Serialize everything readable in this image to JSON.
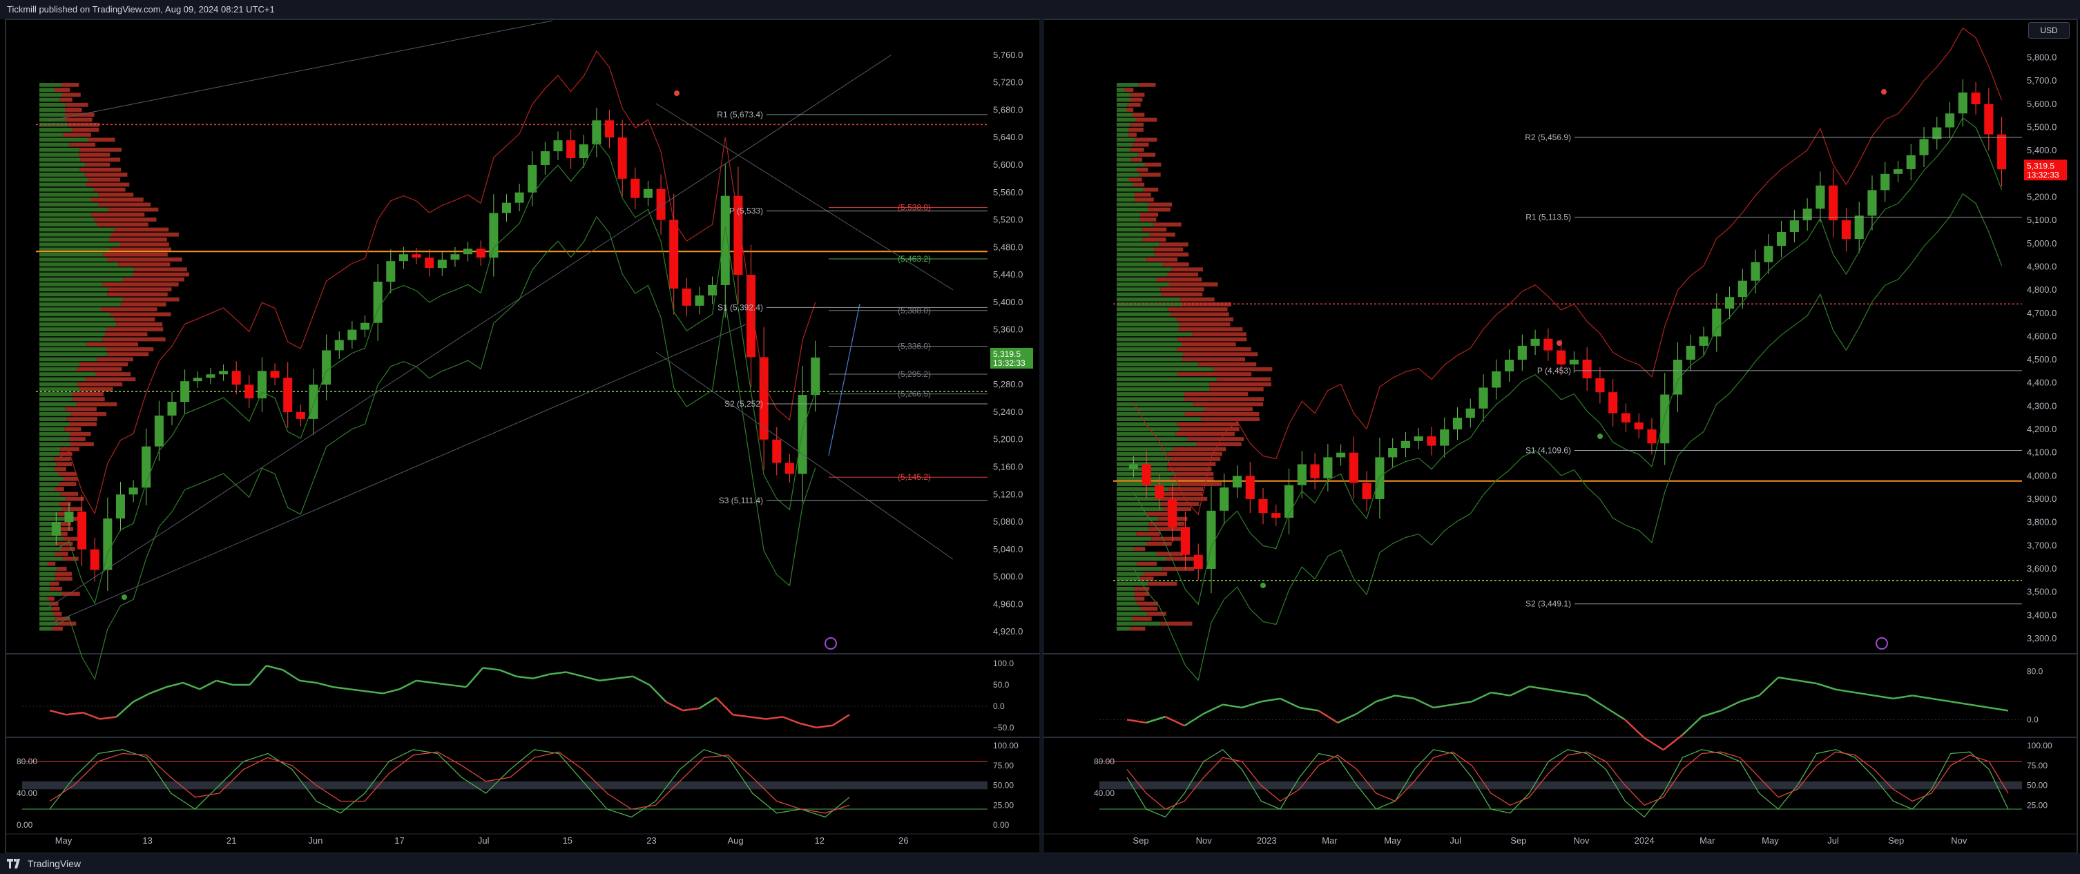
{
  "header": {
    "publisher_line": "Tickmill published on TradingView.com, Aug 09, 2024 08:21 UTC+1"
  },
  "footer": {
    "brand": "TradingView"
  },
  "currency_button": "USD",
  "colors": {
    "up": "#3f9c35",
    "down": "#f20e0e",
    "background": "#000000",
    "panel_border": "#2a2e39",
    "poc": "#f7931e",
    "lime": "#8bd44a"
  },
  "chart_data": [
    {
      "type": "candlestick",
      "panel": "left",
      "ylim": [
        4900,
        5780
      ],
      "y_ticks": [
        "5,760.0",
        "5,720.0",
        "5,680.0",
        "5,640.0",
        "5,600.0",
        "5,560.0",
        "5,520.0",
        "5,480.0",
        "5,440.0",
        "5,400.0",
        "5,360.0",
        "5,320.0",
        "5,280.0",
        "5,240.0",
        "5,200.0",
        "5,160.0",
        "5,120.0",
        "5,080.0",
        "5,040.0",
        "5,000.0",
        "4,960.0",
        "4,920.0"
      ],
      "x_labels": [
        "May",
        "13",
        "21",
        "Jun",
        "17",
        "Jul",
        "15",
        "23",
        "Aug",
        "12",
        "26"
      ],
      "last_price": {
        "value": "5,319.5",
        "countdown": "13:32:33"
      },
      "levels": [
        {
          "label": "R1 (5,673.4)",
          "value": 5673.4
        },
        {
          "label": "P (5,533)",
          "value": 5533
        },
        {
          "label": "(5,538.0)",
          "value": 5538
        },
        {
          "label": "(5,463.2)",
          "value": 5463.2
        },
        {
          "label": "S1 (5,392.4)",
          "value": 5392.4
        },
        {
          "label": "(5,388.0)",
          "value": 5388
        },
        {
          "label": "(5,336.0)",
          "value": 5336
        },
        {
          "label": "(5,295.2)",
          "value": 5295.2
        },
        {
          "label": "(5,266.5)",
          "value": 5266.5
        },
        {
          "label": "S2 (5,252)",
          "value": 5252
        },
        {
          "label": "(5,145.2)",
          "value": 5145.2
        },
        {
          "label": "S3 (5,111.4)",
          "value": 5111.4
        }
      ],
      "series": [
        {
          "name": "",
          "values": [
            5080,
            5095,
            5040,
            5010,
            5085,
            5120,
            5130,
            5190,
            5235,
            5255,
            5285,
            5290,
            5295,
            5300,
            5280,
            5260,
            5300,
            5290,
            5240,
            5230,
            5280,
            5330,
            5345,
            5360,
            5370,
            5430,
            5460,
            5470,
            5465,
            5450,
            5462,
            5470,
            5478,
            5465,
            5530,
            5545,
            5560,
            5600,
            5620,
            5636,
            5610,
            5630,
            5665,
            5640,
            5580,
            5552,
            5565,
            5520,
            5420,
            5395,
            5410,
            5425,
            5555,
            5440,
            5320,
            5200,
            5166,
            5150,
            5265,
            5319.5
          ]
        }
      ]
    },
    {
      "type": "oscillator",
      "panel": "left",
      "ylim": [
        -60,
        110
      ],
      "y_ticks": [
        "100.0",
        "50.0",
        "0.0",
        "−50.0"
      ],
      "series": [
        {
          "name": "",
          "values": [
            -10,
            -20,
            -15,
            -30,
            -25,
            10,
            30,
            45,
            55,
            40,
            60,
            50,
            50,
            95,
            85,
            60,
            55,
            45,
            40,
            35,
            30,
            40,
            60,
            55,
            50,
            45,
            90,
            85,
            70,
            65,
            75,
            80,
            70,
            60,
            65,
            70,
            50,
            10,
            -10,
            -5,
            20,
            -20,
            -25,
            -30,
            -25,
            -40,
            -50,
            -45,
            -20
          ]
        }
      ]
    },
    {
      "type": "stochastic",
      "panel": "left",
      "ylim": [
        0,
        100
      ],
      "y_ticks": [
        "100.00",
        "75.00",
        "50.00",
        "25.00",
        "0.00"
      ],
      "left_ticks": [
        "80.00",
        "40.00",
        "0.00"
      ],
      "series": [
        {
          "name": "",
          "values": [
            20,
            60,
            90,
            95,
            85,
            40,
            20,
            50,
            80,
            90,
            70,
            30,
            15,
            40,
            80,
            95,
            90,
            60,
            40,
            70,
            95,
            90,
            55,
            20,
            10,
            30,
            70,
            95,
            85,
            40,
            15,
            20,
            10,
            35
          ]
        },
        {
          "name": "",
          "values": [
            30,
            50,
            80,
            90,
            88,
            60,
            35,
            40,
            70,
            85,
            75,
            50,
            30,
            30,
            65,
            88,
            92,
            75,
            55,
            60,
            85,
            92,
            70,
            40,
            20,
            25,
            55,
            85,
            88,
            60,
            30,
            20,
            15,
            25
          ]
        }
      ]
    },
    {
      "type": "candlestick",
      "panel": "right",
      "ylim": [
        3270,
        5870
      ],
      "y_ticks": [
        "5,800.0",
        "5,700.0",
        "5,600.0",
        "5,500.0",
        "5,400.0",
        "5,300.0",
        "5,200.0",
        "5,100.0",
        "5,000.0",
        "4,900.0",
        "4,800.0",
        "4,700.0",
        "4,600.0",
        "4,500.0",
        "4,400.0",
        "4,300.0",
        "4,200.0",
        "4,100.0",
        "4,000.0",
        "3,900.0",
        "3,800.0",
        "3,700.0",
        "3,600.0",
        "3,500.0",
        "3,400.0",
        "3,300.0"
      ],
      "x_labels": [
        "Sep",
        "Nov",
        "2023",
        "Mar",
        "May",
        "Jul",
        "Sep",
        "Nov",
        "2024",
        "Mar",
        "May",
        "Jul",
        "Sep",
        "Nov"
      ],
      "last_price": {
        "value": "5,319.5",
        "countdown": "13:32:33"
      },
      "levels": [
        {
          "label": "R2 (5,456.9)",
          "value": 5456.9
        },
        {
          "label": "R1 (5,113.5)",
          "value": 5113.5
        },
        {
          "label": "P (4,453)",
          "value": 4453
        },
        {
          "label": "S1 (4,109.6)",
          "value": 4109.6
        },
        {
          "label": "S2 (3,449.1)",
          "value": 3449.1
        }
      ],
      "series": [
        {
          "name": "",
          "values": [
            4050,
            3960,
            3900,
            3780,
            3660,
            3600,
            3850,
            3950,
            4000,
            3900,
            3840,
            3820,
            3960,
            4050,
            3990,
            4080,
            4100,
            3970,
            3900,
            4080,
            4120,
            4150,
            4170,
            4130,
            4200,
            4250,
            4290,
            4380,
            4450,
            4500,
            4560,
            4590,
            4540,
            4480,
            4500,
            4420,
            4360,
            4270,
            4230,
            4200,
            4140,
            4350,
            4500,
            4560,
            4600,
            4720,
            4770,
            4840,
            4920,
            4990,
            5050,
            5100,
            5150,
            5250,
            5100,
            5020,
            5120,
            5230,
            5300,
            5320,
            5380,
            5450,
            5500,
            5560,
            5650,
            5600,
            5470,
            5319.5
          ]
        }
      ]
    },
    {
      "type": "oscillator",
      "panel": "right",
      "ylim": [
        -20,
        100
      ],
      "y_ticks": [
        "80.0",
        "0.0"
      ],
      "series": [
        {
          "name": "",
          "values": [
            0,
            -5,
            5,
            -10,
            10,
            25,
            20,
            30,
            35,
            20,
            15,
            -5,
            10,
            30,
            40,
            35,
            20,
            25,
            30,
            45,
            40,
            55,
            50,
            45,
            40,
            20,
            0,
            -30,
            -50,
            -25,
            5,
            15,
            30,
            40,
            70,
            65,
            60,
            50,
            45,
            40,
            35,
            40,
            35,
            30,
            25,
            20,
            15
          ]
        }
      ]
    },
    {
      "type": "stochastic",
      "panel": "right",
      "ylim": [
        0,
        100
      ],
      "y_ticks": [
        "100.00",
        "75.00",
        "50.00",
        "25.00"
      ],
      "left_ticks": [
        "80.00",
        "40.00"
      ],
      "series": [
        {
          "name": "",
          "values": [
            60,
            20,
            10,
            40,
            80,
            95,
            70,
            30,
            20,
            60,
            90,
            85,
            50,
            20,
            30,
            70,
            95,
            90,
            60,
            20,
            15,
            40,
            80,
            95,
            90,
            70,
            30,
            10,
            40,
            85,
            95,
            90,
            80,
            40,
            20,
            50,
            90,
            95,
            85,
            60,
            30,
            20,
            45,
            90,
            92,
            70,
            20
          ]
        },
        {
          "name": "",
          "values": [
            70,
            40,
            20,
            30,
            60,
            85,
            80,
            50,
            30,
            45,
            75,
            88,
            70,
            40,
            30,
            55,
            85,
            92,
            75,
            40,
            25,
            35,
            65,
            88,
            92,
            80,
            50,
            25,
            35,
            70,
            90,
            92,
            85,
            60,
            35,
            45,
            75,
            92,
            88,
            70,
            45,
            30,
            40,
            75,
            88,
            80,
            40
          ]
        }
      ]
    }
  ]
}
